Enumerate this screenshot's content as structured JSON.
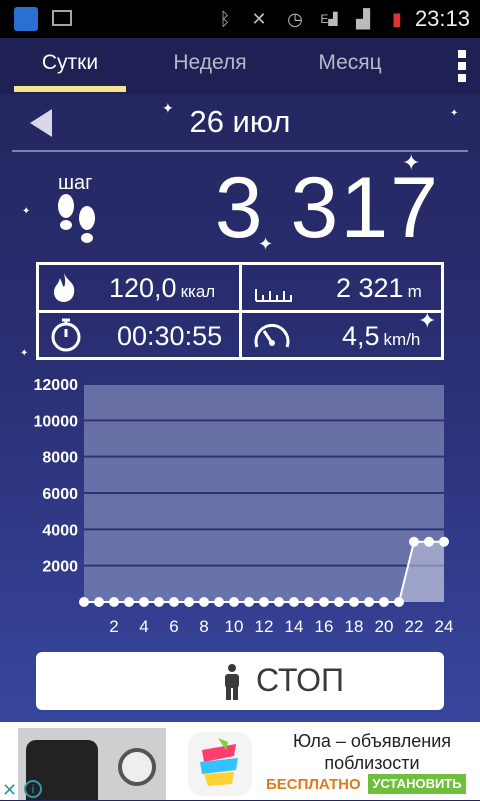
{
  "status_bar": {
    "time": "23:13"
  },
  "tabs": [
    {
      "label": "Сутки",
      "active": true
    },
    {
      "label": "Неделя",
      "active": false
    },
    {
      "label": "Месяц",
      "active": false
    }
  ],
  "date": {
    "label": "26 июл"
  },
  "steps": {
    "label": "шаг",
    "value": "3 317"
  },
  "stats": {
    "calories": {
      "value": "120,0",
      "unit": "ккал",
      "icon": "flame-icon"
    },
    "distance": {
      "value": "2 321",
      "unit": "m",
      "icon": "ruler-icon"
    },
    "duration": {
      "value": "00:30:55",
      "icon": "stopwatch-icon"
    },
    "speed": {
      "value": "4,5",
      "unit": "km/h",
      "icon": "speedometer-icon"
    }
  },
  "chart_data": {
    "type": "area",
    "y_ticks": [
      "12000",
      "10000",
      "8000",
      "6000",
      "4000",
      "2000"
    ],
    "x_ticks": [
      "2",
      "4",
      "6",
      "8",
      "10",
      "12",
      "14",
      "16",
      "18",
      "20",
      "22",
      "24"
    ],
    "ylim": [
      0,
      12000
    ],
    "xlim": [
      0,
      24
    ],
    "x": [
      0,
      1,
      2,
      3,
      4,
      5,
      6,
      7,
      8,
      9,
      10,
      11,
      12,
      13,
      14,
      15,
      16,
      17,
      18,
      19,
      20,
      21,
      22,
      23,
      24
    ],
    "values": [
      0,
      0,
      0,
      0,
      0,
      0,
      0,
      0,
      0,
      0,
      0,
      0,
      0,
      0,
      0,
      0,
      0,
      0,
      0,
      0,
      0,
      0,
      3317,
      3317,
      3317
    ],
    "grid": true
  },
  "stop_button": {
    "label": "СТОП"
  },
  "ad": {
    "title": "Юла – объявления поблизости",
    "free_label": "БЕСПЛАТНО",
    "install_label": "УСТАНОВИТЬ"
  }
}
